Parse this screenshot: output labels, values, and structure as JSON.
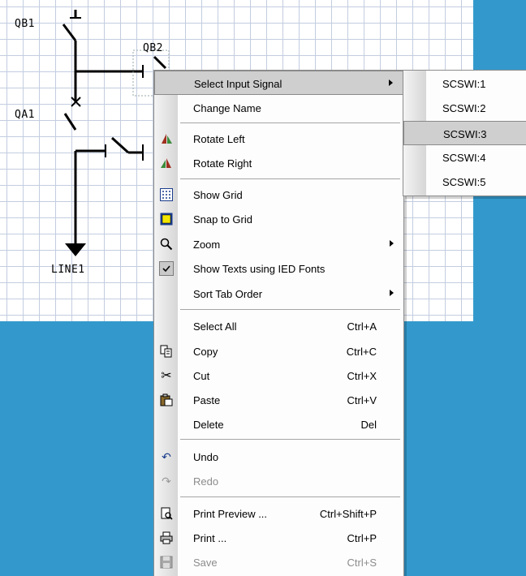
{
  "diagram": {
    "labels": [
      "QB1",
      "QB2",
      "QA1",
      "LINE1"
    ]
  },
  "context_menu": {
    "items": [
      {
        "label": "Select Input Signal",
        "has_submenu": true,
        "highlighted": true
      },
      {
        "label": "Change Name"
      },
      {
        "label": "Rotate Left",
        "icon": "rotate-left-icon"
      },
      {
        "label": "Rotate Right",
        "icon": "rotate-right-icon"
      },
      {
        "label": "Show Grid",
        "icon": "grid-icon"
      },
      {
        "label": "Snap to Grid",
        "icon": "snap-grid-icon"
      },
      {
        "label": "Zoom",
        "icon": "magnifier-icon",
        "has_submenu": true
      },
      {
        "label": "Show Texts using IED Fonts",
        "icon": "checkmark-icon",
        "checked": true
      },
      {
        "label": "Sort Tab Order",
        "has_submenu": true
      },
      {
        "label": "Select All",
        "shortcut": "Ctrl+A"
      },
      {
        "label": "Copy",
        "shortcut": "Ctrl+C",
        "icon": "copy-icon"
      },
      {
        "label": "Cut",
        "shortcut": "Ctrl+X",
        "icon": "scissors-icon"
      },
      {
        "label": "Paste",
        "shortcut": "Ctrl+V",
        "icon": "paste-icon"
      },
      {
        "label": "Delete",
        "shortcut": "Del"
      },
      {
        "label": "Undo",
        "icon": "undo-icon"
      },
      {
        "label": "Redo",
        "icon": "redo-icon",
        "disabled": true
      },
      {
        "label": "Print Preview ...",
        "shortcut": "Ctrl+Shift+P",
        "icon": "print-preview-icon"
      },
      {
        "label": "Print ...",
        "shortcut": "Ctrl+P",
        "icon": "printer-icon"
      },
      {
        "label": "Save",
        "shortcut": "Ctrl+S",
        "icon": "save-icon",
        "disabled": true
      }
    ]
  },
  "submenu": {
    "items": [
      {
        "label": "SCSWI:1"
      },
      {
        "label": "SCSWI:2"
      },
      {
        "label": "SCSWI:3",
        "highlighted": true
      },
      {
        "label": "SCSWI:4"
      },
      {
        "label": "SCSWI:5"
      }
    ]
  },
  "colors": {
    "background": "#3399cc",
    "menu_highlight": "#cfcfcf"
  }
}
